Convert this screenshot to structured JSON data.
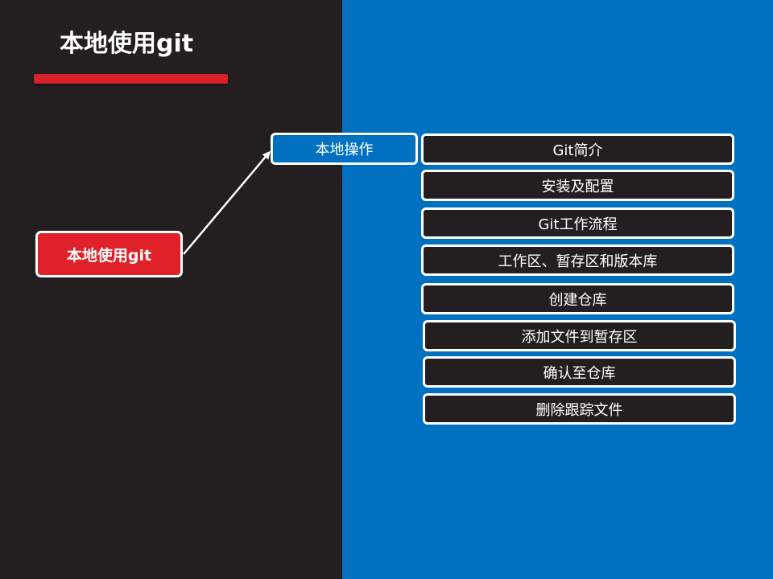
{
  "slide": {
    "title": "本地使用git"
  },
  "diagram": {
    "root": {
      "label": "本地使用git"
    },
    "branch": {
      "label": "本地操作"
    },
    "leaves": [
      {
        "label": "Git简介"
      },
      {
        "label": "安装及配置"
      },
      {
        "label": "Git工作流程"
      },
      {
        "label": "工作区、暂存区和版本库"
      },
      {
        "label": "创建仓库"
      },
      {
        "label": "添加文件到暂存区"
      },
      {
        "label": "确认至仓库"
      },
      {
        "label": "删除跟踪文件"
      }
    ]
  },
  "colors": {
    "dark_panel": "#231f20",
    "blue_panel": "#0070c0",
    "accent_red": "#e02129",
    "border": "#ffffff"
  }
}
